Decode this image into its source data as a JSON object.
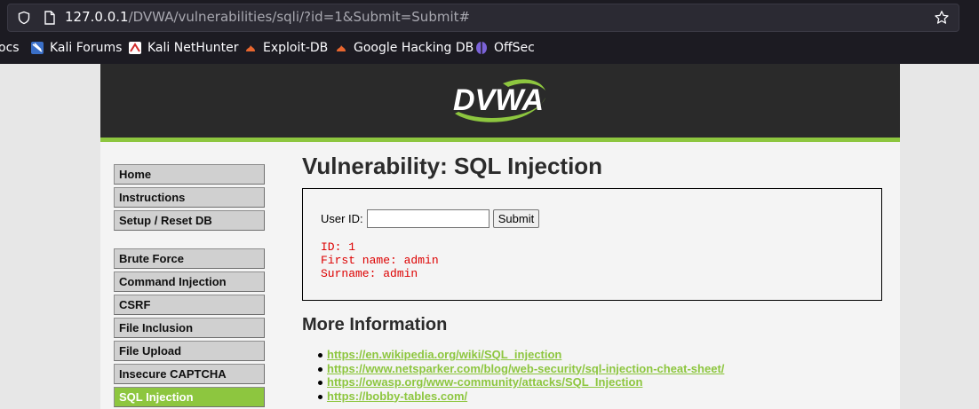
{
  "browser": {
    "url_host": "127.0.0.1",
    "url_path": "/DVWA/vulnerabilities/sqli/?id=1&Submit=Submit#",
    "bookmarks": [
      {
        "label": "ocs",
        "icon": "docs-icon"
      },
      {
        "label": "Kali Forums",
        "icon": "kali-forums-icon"
      },
      {
        "label": "Kali NetHunter",
        "icon": "kali-nethunter-icon"
      },
      {
        "label": "Exploit-DB",
        "icon": "exploit-db-icon"
      },
      {
        "label": "Google Hacking DB",
        "icon": "ghdb-icon"
      },
      {
        "label": "OffSec",
        "icon": "offsec-icon"
      }
    ]
  },
  "header": {
    "logo_text": "DVWA"
  },
  "menu": {
    "items": [
      {
        "label": "Home"
      },
      {
        "label": "Instructions"
      },
      {
        "label": "Setup / Reset DB"
      },
      {
        "label": "Brute Force"
      },
      {
        "label": "Command Injection"
      },
      {
        "label": "CSRF"
      },
      {
        "label": "File Inclusion"
      },
      {
        "label": "File Upload"
      },
      {
        "label": "Insecure CAPTCHA"
      },
      {
        "label": "SQL Injection",
        "active": true
      }
    ]
  },
  "main": {
    "title": "Vulnerability: SQL Injection",
    "form": {
      "label": "User ID:",
      "input_value": "",
      "submit_label": "Submit"
    },
    "result": {
      "line1": "ID: 1",
      "line2": "First name: admin",
      "line3": "Surname: admin"
    },
    "more_title": "More Information",
    "links": [
      "https://en.wikipedia.org/wiki/SQL_injection",
      "https://www.netsparker.com/blog/web-security/sql-injection-cheat-sheet/",
      "https://owasp.org/www-community/attacks/SQL_Injection",
      "https://bobby-tables.com/"
    ]
  },
  "colors": {
    "accent": "#8dc63f",
    "header_bg": "#2a2a2a",
    "result_text": "#dd0000"
  }
}
